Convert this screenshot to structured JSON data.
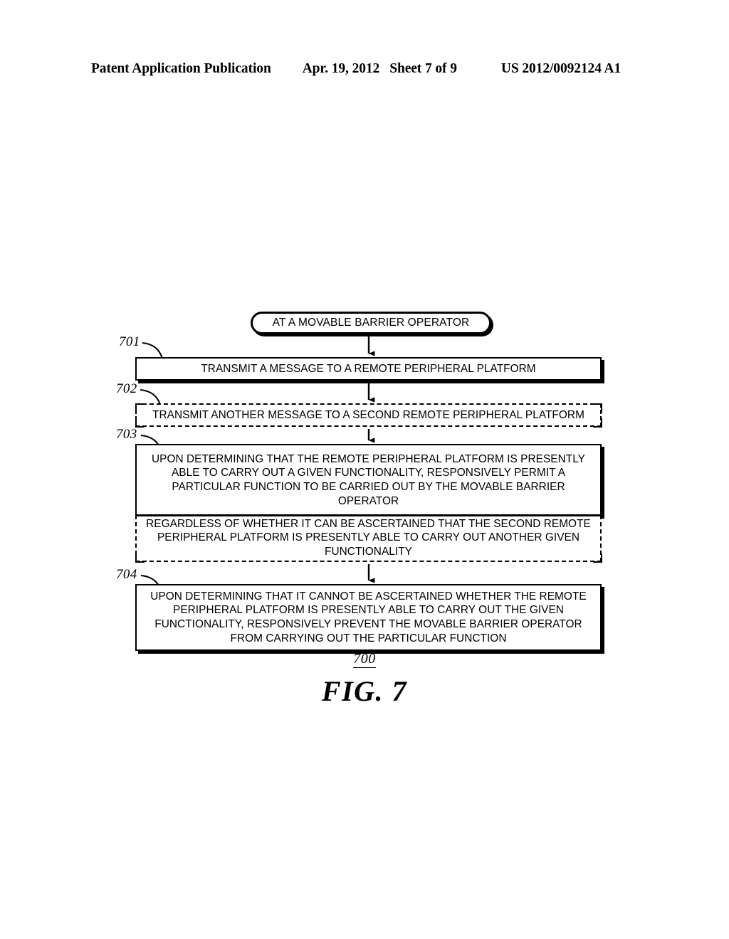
{
  "header": {
    "publication": "Patent Application Publication",
    "date": "Apr. 19, 2012",
    "sheet": "Sheet 7 of 9",
    "patent_number": "US 2012/0092124 A1"
  },
  "figure": {
    "number": "700",
    "label": "FIG. 7"
  },
  "flowchart": {
    "start": {
      "ref": "",
      "text": "AT A MOVABLE BARRIER OPERATOR"
    },
    "steps": [
      {
        "ref": "701",
        "style": "solid",
        "text": "TRANSMIT A MESSAGE TO A REMOTE PERIPHERAL PLATFORM"
      },
      {
        "ref": "702",
        "style": "dashed",
        "text": "TRANSMIT ANOTHER MESSAGE TO A SECOND REMOTE PERIPHERAL PLATFORM"
      },
      {
        "ref": "703",
        "style": "solid",
        "text": "UPON DETERMINING THAT THE REMOTE PERIPHERAL PLATFORM IS PRESENTLY ABLE TO CARRY OUT A GIVEN FUNCTIONALITY, RESPONSIVELY PERMIT A PARTICULAR FUNCTION TO BE CARRIED OUT BY THE MOVABLE BARRIER OPERATOR"
      },
      {
        "ref": "",
        "style": "dashed",
        "text": "REGARDLESS OF WHETHER IT CAN BE ASCERTAINED THAT THE SECOND REMOTE PERIPHERAL PLATFORM IS PRESENTLY ABLE TO CARRY OUT ANOTHER GIVEN FUNCTIONALITY"
      },
      {
        "ref": "704",
        "style": "solid",
        "text": "UPON DETERMINING THAT IT CANNOT BE ASCERTAINED WHETHER THE REMOTE PERIPHERAL PLATFORM IS PRESENTLY ABLE TO CARRY OUT THE GIVEN FUNCTIONALITY, RESPONSIVELY PREVENT THE MOVABLE BARRIER OPERATOR FROM CARRYING OUT THE PARTICULAR FUNCTION"
      }
    ]
  }
}
